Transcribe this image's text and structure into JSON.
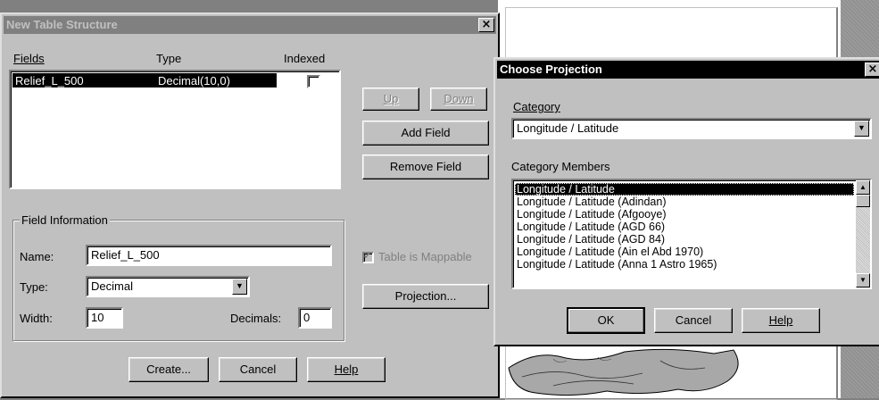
{
  "new_table": {
    "title": "New Table Structure",
    "close_glyph": "×",
    "fields_header": {
      "fields": "Fields",
      "type": "Type",
      "indexed": "Indexed"
    },
    "rows": [
      {
        "field": "Relief_L_500",
        "type": "Decimal(10,0)",
        "indexed": false
      }
    ],
    "buttons": {
      "up": "Up",
      "down": "Down",
      "add_field": "Add Field",
      "remove_field": "Remove Field",
      "projection": "Projection...",
      "create": "Create...",
      "cancel": "Cancel",
      "help": "Help"
    },
    "field_info": {
      "group_label": "Field Information",
      "name_label": "Name:",
      "name_value": "Relief_L_500",
      "type_label": "Type:",
      "type_value": "Decimal",
      "width_label": "Width:",
      "width_value": "10",
      "decimals_label": "Decimals:",
      "decimals_value": "0"
    },
    "mappable": {
      "label": "Table is Mappable",
      "checked": true
    }
  },
  "choose_projection": {
    "title": "Choose Projection",
    "close_glyph": "×",
    "category_label": "Category",
    "category_value": "Longitude / Latitude",
    "members_label": "Category Members",
    "members": [
      "Longitude / Latitude",
      "Longitude / Latitude (Adindan)",
      "Longitude / Latitude (Afgooye)",
      "Longitude / Latitude (AGD 66)",
      "Longitude / Latitude (AGD 84)",
      "Longitude / Latitude (Ain el Abd 1970)",
      "Longitude / Latitude (Anna 1 Astro 1965)"
    ],
    "selected_index": 0,
    "buttons": {
      "ok": "OK",
      "cancel": "Cancel",
      "help": "Help"
    }
  },
  "colors": {
    "title_active": "#000000",
    "title_inactive": "#808080",
    "face": "#c0c0c0"
  }
}
